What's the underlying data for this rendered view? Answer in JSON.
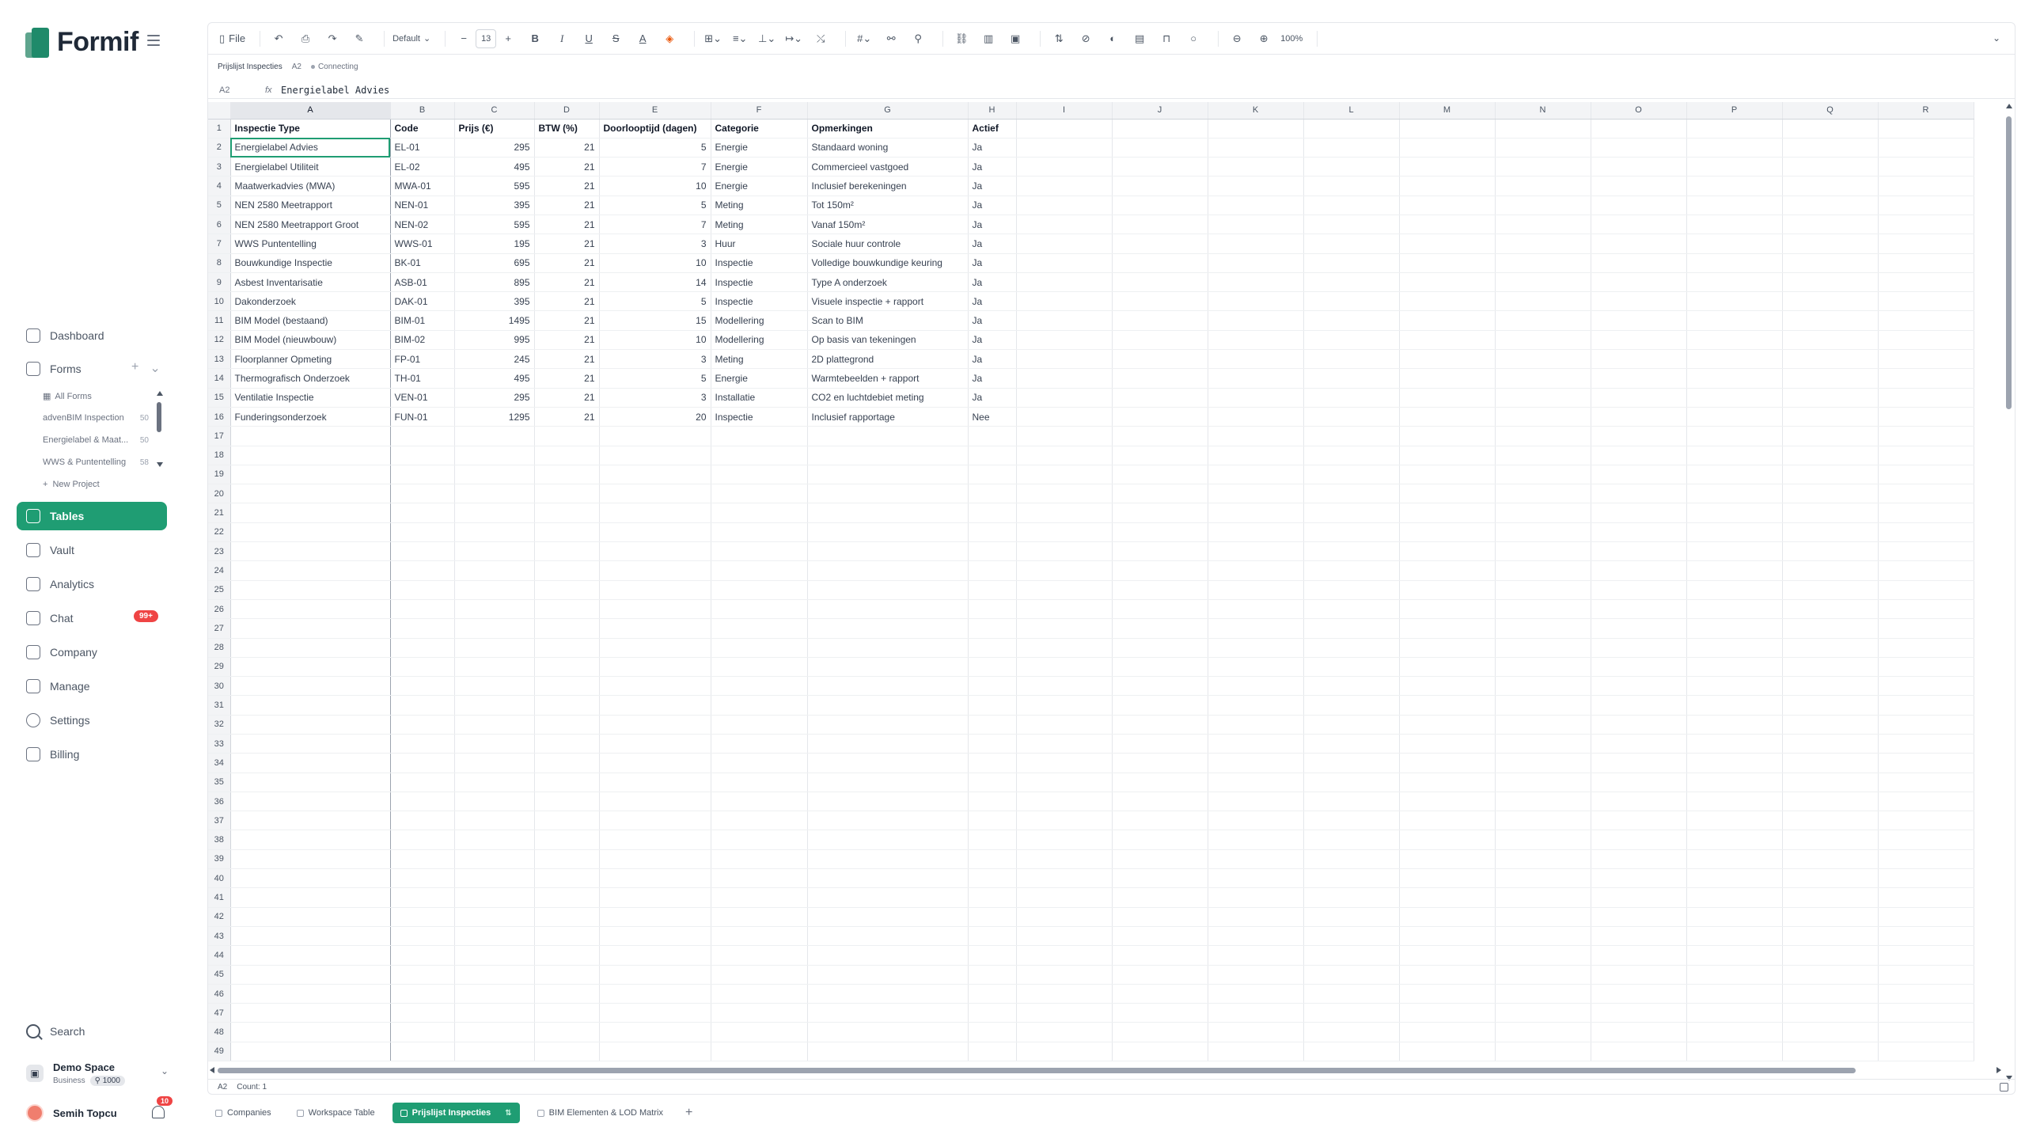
{
  "app": {
    "name": "Formif"
  },
  "sidebar": {
    "nav": [
      {
        "label": "Dashboard",
        "icon": "dashboard-icon"
      },
      {
        "label": "Forms",
        "icon": "forms-icon"
      },
      {
        "label": "Tables",
        "icon": "table-icon"
      },
      {
        "label": "Vault",
        "icon": "vault-icon"
      },
      {
        "label": "Analytics",
        "icon": "analytics-icon"
      },
      {
        "label": "Chat",
        "icon": "chat-icon"
      },
      {
        "label": "Company",
        "icon": "company-icon"
      },
      {
        "label": "Manage",
        "icon": "sliders-icon"
      },
      {
        "label": "Settings",
        "icon": "gear-icon"
      },
      {
        "label": "Billing",
        "icon": "card-icon"
      }
    ],
    "forms_sub": [
      {
        "label": "All Forms",
        "count": ""
      },
      {
        "label": "advenBIM Inspection",
        "count": "50"
      },
      {
        "label": "Energielabel & Maat...",
        "count": "50"
      },
      {
        "label": "WWS & Puntentelling",
        "count": "58"
      },
      {
        "label": "New Project",
        "count": ""
      }
    ],
    "chat_badge": "99+",
    "search_label": "Search",
    "space": {
      "name": "Demo Space",
      "plan": "Business",
      "credits": "1000"
    },
    "user": {
      "name": "Semih Topcu",
      "notifications": "10"
    }
  },
  "toolbar": {
    "file_label": "File",
    "font_name": "Default",
    "font_size": "13",
    "zoom": "100%"
  },
  "info": {
    "sheet_name": "Prijslijst Inspecties",
    "cell_ref": "A2",
    "status": "Connecting"
  },
  "formula": {
    "ref": "A2",
    "fx": "fx",
    "value": "Energielabel Advies"
  },
  "columns": [
    "A",
    "B",
    "C",
    "D",
    "E",
    "F",
    "G",
    "H",
    "I",
    "J",
    "K",
    "L",
    "M",
    "N",
    "O",
    "P",
    "Q",
    "R"
  ],
  "headers": [
    "Inspectie Type",
    "Code",
    "Prijs (€)",
    "BTW (%)",
    "Doorlooptijd (dagen)",
    "Categorie",
    "Opmerkingen",
    "Actief"
  ],
  "rows": [
    [
      "Energielabel Advies",
      "EL-01",
      "295",
      "21",
      "5",
      "Energie",
      "Standaard woning",
      "Ja"
    ],
    [
      "Energielabel Utiliteit",
      "EL-02",
      "495",
      "21",
      "7",
      "Energie",
      "Commercieel vastgoed",
      "Ja"
    ],
    [
      "Maatwerkadvies (MWA)",
      "MWA-01",
      "595",
      "21",
      "10",
      "Energie",
      "Inclusief berekeningen",
      "Ja"
    ],
    [
      "NEN 2580 Meetrapport",
      "NEN-01",
      "395",
      "21",
      "5",
      "Meting",
      "Tot 150m²",
      "Ja"
    ],
    [
      "NEN 2580 Meetrapport Groot",
      "NEN-02",
      "595",
      "21",
      "7",
      "Meting",
      "Vanaf 150m²",
      "Ja"
    ],
    [
      "WWS Puntentelling",
      "WWS-01",
      "195",
      "21",
      "3",
      "Huur",
      "Sociale huur controle",
      "Ja"
    ],
    [
      "Bouwkundige Inspectie",
      "BK-01",
      "695",
      "21",
      "10",
      "Inspectie",
      "Volledige bouwkundige keuring",
      "Ja"
    ],
    [
      "Asbest Inventarisatie",
      "ASB-01",
      "895",
      "21",
      "14",
      "Inspectie",
      "Type A onderzoek",
      "Ja"
    ],
    [
      "Dakonderzoek",
      "DAK-01",
      "395",
      "21",
      "5",
      "Inspectie",
      "Visuele inspectie + rapport",
      "Ja"
    ],
    [
      "BIM Model (bestaand)",
      "BIM-01",
      "1495",
      "21",
      "15",
      "Modellering",
      "Scan to BIM",
      "Ja"
    ],
    [
      "BIM Model (nieuwbouw)",
      "BIM-02",
      "995",
      "21",
      "10",
      "Modellering",
      "Op basis van tekeningen",
      "Ja"
    ],
    [
      "Floorplanner Opmeting",
      "FP-01",
      "245",
      "21",
      "3",
      "Meting",
      "2D plattegrond",
      "Ja"
    ],
    [
      "Thermografisch Onderzoek",
      "TH-01",
      "495",
      "21",
      "5",
      "Energie",
      "Warmtebeelden + rapport",
      "Ja"
    ],
    [
      "Ventilatie Inspectie",
      "VEN-01",
      "295",
      "21",
      "3",
      "Installatie",
      "CO2 en luchtdebiet meting",
      "Ja"
    ],
    [
      "Funderingsonderzoek",
      "FUN-01",
      "1295",
      "21",
      "20",
      "Inspectie",
      "Inclusief rapportage",
      "Nee"
    ]
  ],
  "visible_row_count": 49,
  "statusbar": {
    "ref": "A2",
    "count": "Count: 1"
  },
  "sheet_tabs": [
    {
      "label": "Companies",
      "active": false
    },
    {
      "label": "Workspace Table",
      "active": false
    },
    {
      "label": "Prijslijst Inspecties",
      "active": true
    },
    {
      "label": "BIM Elementen & LOD Matrix",
      "active": false
    }
  ],
  "colors": {
    "accent": "#1f9d73",
    "badge": "#ef4444"
  }
}
